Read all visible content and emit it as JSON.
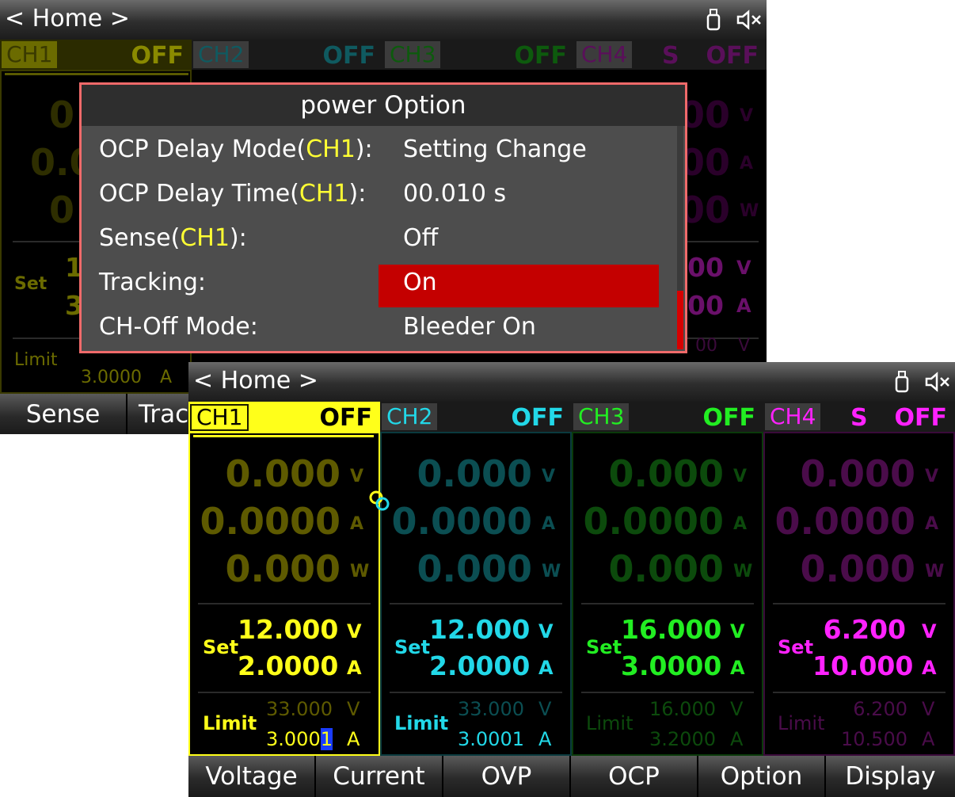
{
  "screen_a": {
    "title": "< Home >",
    "channel_headers": [
      {
        "name": "CH1",
        "status": "OFF"
      },
      {
        "name": "CH2",
        "status": "OFF"
      },
      {
        "name": "CH3",
        "status": "OFF"
      },
      {
        "name": "CH4",
        "mode": "S",
        "status": "OFF"
      }
    ],
    "background_fragments": {
      "set_label": "Set",
      "limit_label": "Limit",
      "limit_current": "3.0000",
      "limit_current_unit": "A",
      "meas_digit_1": "0",
      "meas_digit_2": "0.0",
      "meas_digit_3": "0",
      "set_digit_1": "1",
      "set_digit_2": "3",
      "right_meas_1": "00",
      "right_meas_2": "00",
      "right_meas_3": "00",
      "right_meas_unit_1": "V",
      "right_meas_unit_2": "A",
      "right_meas_unit_3": "W",
      "right_set_1": "00",
      "right_set_2": "00",
      "right_set_unit_1": "V",
      "right_set_unit_2": "A",
      "right_lim_1": "00",
      "right_lim_unit_1": "V"
    },
    "softkeys": [
      "Sense",
      "Trac"
    ],
    "dialog": {
      "title": "power Option",
      "rows": [
        {
          "key_pre": "OCP Delay Mode(",
          "key_ch": "CH1",
          "key_post": "):",
          "value": "Setting Change"
        },
        {
          "key_pre": "OCP Delay Time(",
          "key_ch": "CH1",
          "key_post": "):",
          "value": "00.010 s"
        },
        {
          "key_pre": "Sense(",
          "key_ch": "CH1",
          "key_post": "):",
          "value": "Off"
        },
        {
          "key_pre": "Tracking:",
          "key_ch": "",
          "key_post": "",
          "value": "On"
        },
        {
          "key_pre": "CH-Off Mode:",
          "key_ch": "",
          "key_post": "",
          "value": "Bleeder On"
        }
      ],
      "selected_row": "Tracking:"
    }
  },
  "screen_b": {
    "title": "< Home >",
    "colors": {
      "ch1": "#ffff1a",
      "ch2": "#22d8e8",
      "ch3": "#22ee22",
      "ch4": "#ff22ff"
    },
    "channels": [
      {
        "name": "CH1",
        "mode": "",
        "status": "OFF",
        "meas_v": "0.000",
        "meas_a": "0.0000",
        "meas_w": "0.000",
        "u_v": "V",
        "u_a": "A",
        "u_w": "W",
        "set_label": "Set",
        "set_v": "12.000",
        "set_a": "2.0000",
        "limit_label": "Limit",
        "limit_v": "33.000",
        "limit_a_pre": "3.000",
        "limit_a_cursor": "1"
      },
      {
        "name": "CH2",
        "mode": "",
        "status": "OFF",
        "meas_v": "0.000",
        "meas_a": "0.0000",
        "meas_w": "0.000",
        "u_v": "V",
        "u_a": "A",
        "u_w": "W",
        "set_label": "Set",
        "set_v": "12.000",
        "set_a": "2.0000",
        "limit_label": "Limit",
        "limit_v": "33.000",
        "limit_a": "3.0001"
      },
      {
        "name": "CH3",
        "mode": "",
        "status": "OFF",
        "meas_v": "0.000",
        "meas_a": "0.0000",
        "meas_w": "0.000",
        "u_v": "V",
        "u_a": "A",
        "u_w": "W",
        "set_label": "Set",
        "set_v": "16.000",
        "set_a": "3.0000",
        "limit_label": "Limit",
        "limit_v": "16.000",
        "limit_a": "3.2000"
      },
      {
        "name": "CH4",
        "mode": "S",
        "status": "OFF",
        "meas_v": "0.000",
        "meas_a": "0.0000",
        "meas_w": "0.000",
        "u_v": "V",
        "u_a": "A",
        "u_w": "W",
        "set_label": "Set",
        "set_v": "6.200",
        "set_a": "10.000",
        "limit_label": "Limit",
        "limit_v": "6.200",
        "limit_a": "10.500"
      }
    ],
    "softkeys": [
      "Voltage",
      "Current",
      "OVP",
      "OCP",
      "Option",
      "Display"
    ],
    "icons": [
      "usb-icon",
      "mute-icon",
      "track-link-icon"
    ]
  }
}
